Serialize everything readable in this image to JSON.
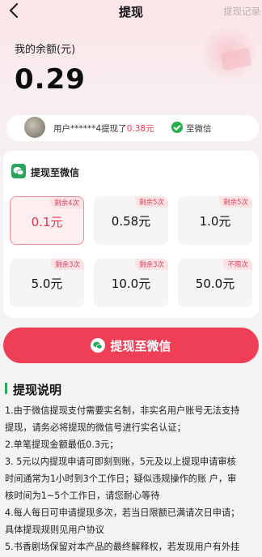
{
  "header": {
    "back_icon": "back-arrow-icon",
    "title": "提现",
    "record_link": "提现记录"
  },
  "balance": {
    "label": "我的余额(元)",
    "value": "0.29"
  },
  "notice": {
    "user": "用户******4提现了",
    "amount": "0.38元",
    "to": "至微信"
  },
  "withdraw_card": {
    "title": "提现至微信",
    "options": [
      {
        "badge": "剩余4次",
        "amount": "0.1元",
        "selected": true
      },
      {
        "badge": "剩余5次",
        "amount": "0.58元",
        "selected": false
      },
      {
        "badge": "剩余5次",
        "amount": "1.0元",
        "selected": false
      },
      {
        "badge": "剩余3次",
        "amount": "5.0元",
        "selected": false
      },
      {
        "badge": "剩余3次",
        "amount": "10.0元",
        "selected": false
      },
      {
        "badge": "不限次",
        "amount": "50.0元",
        "selected": false
      }
    ]
  },
  "submit_button": {
    "label": "提现至微信"
  },
  "instructions": {
    "title": "提现说明",
    "lines": [
      "1.由于微信提现支付需要实名制，非实名用户账号无法支持",
      "提现，请务必将提现的微信号进行实名认证；",
      "2.单笔提现金额最低0.3元；",
      "3. 5元以内提现申请可即刻到账，5元及以上提现申请审核",
      "时间通常为1小时到3个工作日；疑似违规操作的账 户，审",
      "核时间为1~5个工作日，请您耐心等待",
      "4.每人每日可申请提现多次，若当日限额已满请次日申请；",
      "具体提现规则见用户协议",
      "5.书香剧场保留对本产品的最终解释权，若发现用户有外挂"
    ]
  },
  "colors": {
    "accent": "#ef3f57",
    "wechat": "#22b14c"
  }
}
